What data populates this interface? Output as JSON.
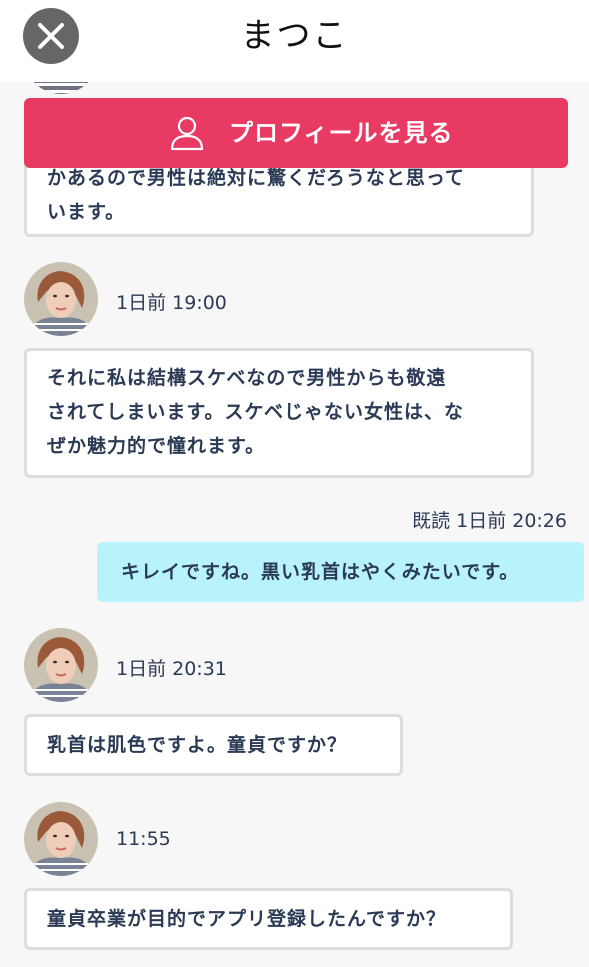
{
  "header": {
    "title": "まつこ",
    "close_icon": "close-icon"
  },
  "profile_button": {
    "label": "プロフィールを見る",
    "icon": "person-icon",
    "color": "#e83a63"
  },
  "messages": [
    {
      "from": "partner",
      "partial_text_line1": "かあるので男性は絶対に驚くだろうなと思って",
      "text_line2": "います。"
    },
    {
      "from": "partner",
      "time": "1日前 19:00",
      "lines": [
        "それに私は結構スケベなので男性からも敬遠",
        "されてしまいます。スケベじゃない女性は、な",
        "ぜか魅力的で憧れます。"
      ]
    },
    {
      "from": "me",
      "read_time": "既読 1日前 20:26",
      "text": "キレイですね。黒い乳首はやくみたいです。"
    },
    {
      "from": "partner",
      "time": "1日前 20:31",
      "text": "乳首は肌色ですよ。童貞ですか？"
    },
    {
      "from": "partner",
      "time": "11:55",
      "text": "童貞卒業が目的でアプリ登録したんですか？"
    }
  ],
  "colors": {
    "my_bubble": "#b8f3fb",
    "partner_bubble": "#ffffff",
    "text": "#2b3a55"
  }
}
